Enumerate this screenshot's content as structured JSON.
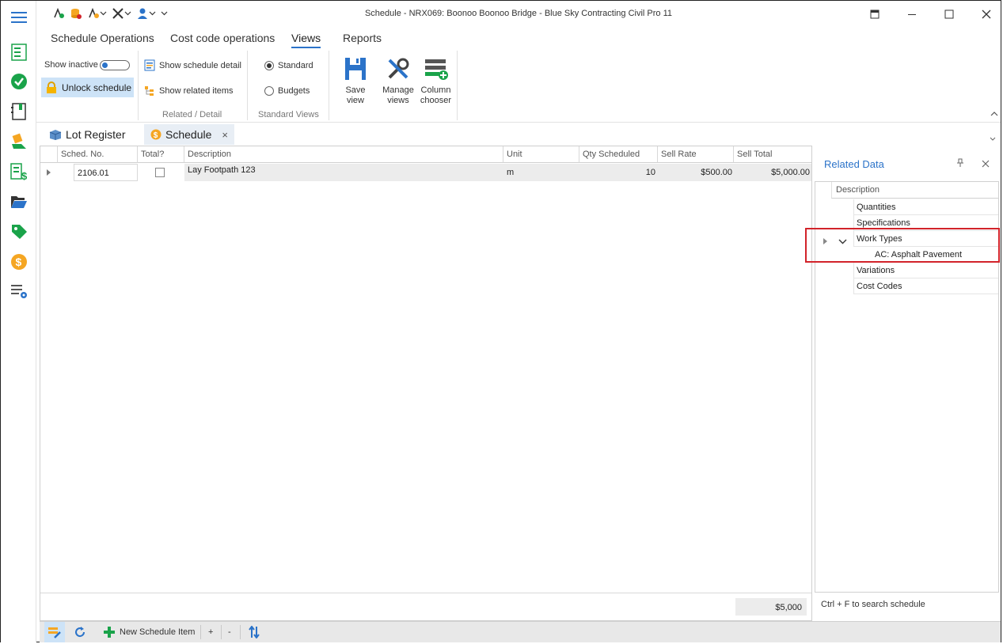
{
  "window": {
    "title": "Schedule - NRX069: Boonoo Boonoo Bridge  - Blue Sky Contracting Civil Pro 11"
  },
  "ribbon_tabs": [
    "Schedule Operations",
    "Cost code operations",
    "Views",
    "Reports"
  ],
  "ribbon": {
    "show_inactive": "Show inactive",
    "unlock_schedule": "Unlock schedule",
    "show_schedule_detail": "Show schedule detail",
    "show_related_items": "Show related items",
    "group_related_detail": "Related / Detail",
    "standard": "Standard",
    "budgets": "Budgets",
    "group_standard_views": "Standard Views",
    "save_view": "Save view",
    "manage_views_1": "Manage",
    "manage_views_2": "views",
    "column_chooser_1": "Column",
    "column_chooser_2": "chooser",
    "standard_selected": true
  },
  "doc_tabs": {
    "lot_register": "Lot Register",
    "schedule": "Schedule",
    "close": "×"
  },
  "grid": {
    "headers": [
      "Sched. No.",
      "Total?",
      "Description",
      "Unit",
      "Qty Scheduled",
      "Sell Rate",
      "Sell Total"
    ],
    "rows": [
      {
        "sched_no": "2106.01",
        "total": false,
        "description": "Lay Footpath  123",
        "unit": "m",
        "qty": "10",
        "rate": "$500.00",
        "sell_total": "$5,000.00"
      }
    ],
    "footer_total": "$5,000"
  },
  "related": {
    "title": "Related Data",
    "header": "Description",
    "items": [
      "Quantities",
      "Specifications",
      "Work Types",
      "AC: Asphalt Pavement",
      "Variations",
      "Cost Codes"
    ],
    "search_hint": "Ctrl + F to search schedule"
  },
  "bottombar": {
    "new_item": "New Schedule Item",
    "plus": "+",
    "minus": "-"
  },
  "colors": {
    "accent": "#2b73c9",
    "highlight": "#d2232a",
    "green": "#1aa34a",
    "orange": "#f5a623"
  }
}
